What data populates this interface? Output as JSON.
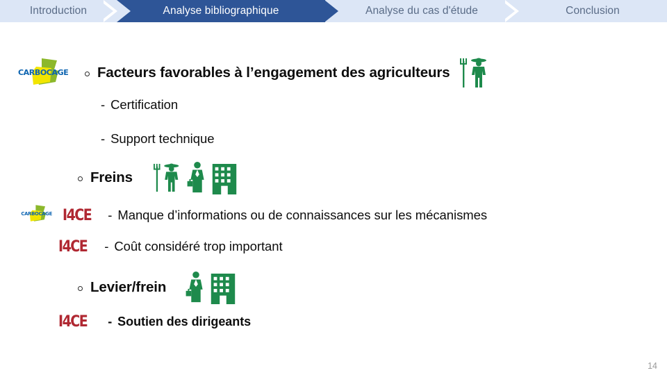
{
  "nav": {
    "items": [
      {
        "label": "Introduction",
        "active": false
      },
      {
        "label": "Analyse bibliographique",
        "active": true
      },
      {
        "label": "Analyse du cas d'étude",
        "active": false
      },
      {
        "label": "Conclusion",
        "active": false
      }
    ],
    "active_bg": "#2e5597",
    "inactive_bg": "#dce6f6",
    "inactive_text": "#5a6c87",
    "active_text": "#ffffff"
  },
  "logos": {
    "carbocage_text": "CARBOCAGE",
    "i4ce_text": "I4CE",
    "carbocage_blue": "#0b63b0",
    "carbocage_green": "#8cb82b",
    "carbocage_yellow": "#f2e500",
    "i4ce_red": "#b02832"
  },
  "slide": {
    "blocks": [
      {
        "id": "facteurs",
        "bullet": "o",
        "text": "Facteurs favorables à l’engagement des agriculteurs",
        "level": 1,
        "logo": "carbocage",
        "icons": [
          "farmer-icon"
        ]
      },
      {
        "id": "certification",
        "bullet": "-",
        "text": "Certification",
        "level": 2,
        "logo": null,
        "icons": []
      },
      {
        "id": "support-technique",
        "bullet": "-",
        "text": "Support technique",
        "level": 2,
        "logo": null,
        "icons": []
      },
      {
        "id": "freins",
        "bullet": "o",
        "text": "Freins",
        "level": 1,
        "logo": null,
        "icons": [
          "farmer-icon",
          "businessman-icon",
          "building-icon"
        ]
      },
      {
        "id": "manque-informations",
        "bullet": "-",
        "text": "Manque d’informations ou de connaissances sur les mécanismes",
        "level": 2,
        "logo": "carbocage-and-i4ce",
        "icons": []
      },
      {
        "id": "cout-considere",
        "bullet": "-",
        "text": "Coût considéré trop important",
        "level": 2,
        "logo": "i4ce",
        "icons": []
      },
      {
        "id": "levier-frein",
        "bullet": "o",
        "text": "Levier/frein",
        "level": 1,
        "logo": null,
        "icons": [
          "businessman-icon",
          "building-icon"
        ]
      },
      {
        "id": "soutien-dirigeants",
        "bullet": "-",
        "text": "Soutien des dirigeants",
        "level": 2,
        "bold": true,
        "logo": "i4ce",
        "icons": []
      }
    ]
  },
  "footer": {
    "page_number": "14"
  },
  "colors": {
    "icon_green": "#1e8a4c",
    "text": "#0d0d0d",
    "page_number": "#9a9a9a"
  }
}
